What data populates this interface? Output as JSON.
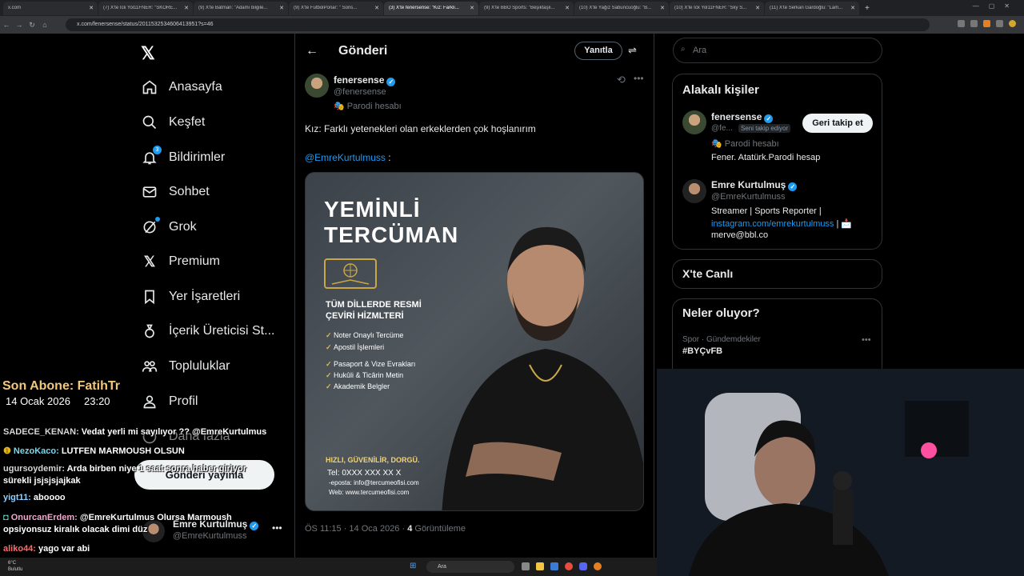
{
  "browser": {
    "tabs": [
      {
        "title": "x.com"
      },
      {
        "title": "(7) X'te Ick Yol11FNER: \"SKORE..."
      },
      {
        "title": "(9) X'te Batman: \"Adamı bilgile..."
      },
      {
        "title": "(9) X'te FutbolPonar: \"  Sons..."
      },
      {
        "title": "(3) X'te fenersense: \"Kız: Farklı..."
      },
      {
        "title": "(9) X'te BBO Sports: \"Beşiktaşlı..."
      },
      {
        "title": "(10) X'te Yağız Sabuncuoğlu: \"B..."
      },
      {
        "title": "(10) X'te Ick Yol11FNER: \"Sky S..."
      },
      {
        "title": "(11) X'te Serkan Gardoğlu: \"Lam..."
      }
    ],
    "active_tab": 4,
    "new_tab": "+",
    "url": "x.com/fenersense/status/2011532534606413951?s=46"
  },
  "nav": {
    "items": [
      {
        "label": "Anasayfa",
        "icon": "home-icon"
      },
      {
        "label": "Keşfet",
        "icon": "search-icon"
      },
      {
        "label": "Bildirimler",
        "icon": "bell-icon",
        "badge": "3"
      },
      {
        "label": "Sohbet",
        "icon": "mail-icon"
      },
      {
        "label": "Grok",
        "icon": "grok-icon"
      },
      {
        "label": "Premium",
        "icon": "x-icon"
      },
      {
        "label": "Yer İşaretleri",
        "icon": "bookmark-icon"
      },
      {
        "label": "İçerik Üreticisi St...",
        "icon": "creator-icon"
      },
      {
        "label": "Topluluklar",
        "icon": "people-icon"
      },
      {
        "label": "Profil",
        "icon": "profile-icon"
      },
      {
        "label": "Daha fazla",
        "icon": "more-icon"
      }
    ],
    "post_button": "Gönderi yayınla",
    "account": {
      "name": "Emre Kurtulmuş",
      "handle": "@EmreKurtulmuss"
    }
  },
  "post": {
    "header_title": "Gönderi",
    "reply_button": "Yanıtla",
    "author": {
      "name": "fenersense",
      "handle": "@fenersense",
      "label": "Parodi hesabı"
    },
    "text": "Kız: Farklı yetenekleri olan erkeklerden çok hoşlanırım",
    "mention": "@EmreKurtulmuss",
    "mention_suffix": " :",
    "image": {
      "headline1": "YEMİNLİ",
      "headline2": "TERCÜMAN",
      "subtitle": "TÜM DİLLERDE RESMİ ÇEVİRİ HİZMLTERİ",
      "list": [
        "Noter Onaylı Tercüme",
        "Apostil İşlemleri",
        "Pasaport & Vize Evrakları",
        "Hukûli & Ticârin Metin",
        "Akademik Belgler"
      ],
      "slogan": "HIZLI, GÜVENİLİR, DORGÜ.",
      "tel": "Tel: 0XXX XXX XX X",
      "email": "-eposta: info@tercumeofisi.com",
      "web": "Web: www.tercumeofisi.com"
    },
    "time": "ÖS 11:15 · 14 Oca 2026 · ",
    "views_count": "4",
    "views_label": " Görüntüleme"
  },
  "sidebar": {
    "search_placeholder": "Ara",
    "related_title": "Alakalı kişiler",
    "person1": {
      "name": "fenersense",
      "handle": "@fe...",
      "follows_you": "Seni takip ediyor",
      "label": "Parodi hesabı",
      "bio": "Fener. Atatürk.Parodi hesap",
      "button": "Geri takip et"
    },
    "person2": {
      "name": "Emre Kurtulmuş",
      "handle": "@EmreKurtulmuss",
      "bio1": "Streamer | Sports Reporter |",
      "link": "instagram.com/emrekurtulmuss",
      "bio_sep": " | 📩",
      "bio3": "merve@bbl.co"
    },
    "live_title": "X'te Canlı",
    "trends_title": "Neler oluyor?",
    "trend_category": "Spor · Gündemdekiler",
    "trend_tag": "#BYÇvFB"
  },
  "overlay": {
    "sub_title": "Son Abone: FatihTr",
    "sub_date": "14 Ocak 2026",
    "sub_time": "23:20",
    "chat": [
      {
        "user": "SADECE_KENAN:",
        "msg": " Vedat yerli mi sayılıyor ?? @EmreKurtulmus"
      },
      {
        "user": "NezoKaco:",
        "msg": " LUTFEN MARMOUSH OLSUN"
      },
      {
        "user": "ugursoydemir:",
        "msg": " Arda birben niye 1 saat sonra haber giriyor sürekli jsjsjsjajkak"
      },
      {
        "user": "yigt11:",
        "msg": " aboooo"
      },
      {
        "user": "OnurcanErdem:",
        "msg": " @EmreKurtulmus Olursa Marmoush opsiyonsuz kiralık olacak dimi düz"
      },
      {
        "user": "aliko44:",
        "msg": " yago var abi"
      }
    ]
  },
  "taskbar": {
    "search": "Ara",
    "weather_temp": "6°C",
    "weather_desc": "Bulutlu"
  },
  "colors": {
    "accent": "#1d9bf0",
    "background": "#000000",
    "text": "#e7e9ea",
    "muted": "#71767b"
  }
}
